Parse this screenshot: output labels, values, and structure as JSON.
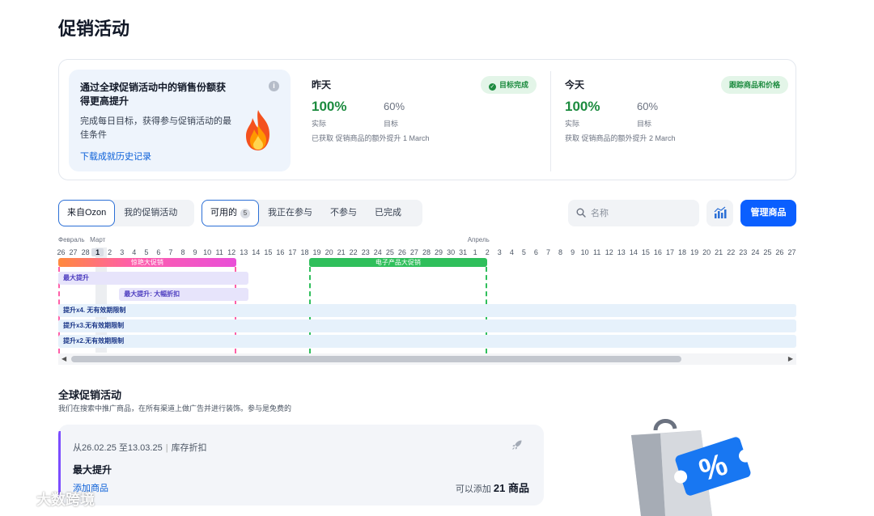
{
  "page": {
    "title": "促销活动"
  },
  "summary": {
    "promo": {
      "title": "通过全球促销活动中的销售份额获得更高提升",
      "description": "完成每日目标，获得参与促销活动的最佳条件",
      "link": "下载成就历史记录"
    },
    "yesterday": {
      "label": "昨天",
      "badge": "目标完成",
      "actual_value": "100%",
      "actual_label": "实际",
      "target_value": "60%",
      "target_label": "目标",
      "note": "已获取 促销商品的额外提升 1 March"
    },
    "today": {
      "label": "今天",
      "badge": "跟踪商品和价格",
      "actual_value": "100%",
      "actual_label": "实际",
      "target_value": "60%",
      "target_label": "目标",
      "note": "获取 促销商品的额外提升 2 March"
    }
  },
  "filters": {
    "source": [
      {
        "label": "来自Ozon",
        "active": true
      },
      {
        "label": "我的促销活动",
        "active": false
      }
    ],
    "status": [
      {
        "label": "可用的",
        "count": "5",
        "active": true
      },
      {
        "label": "我正在参与",
        "active": false
      },
      {
        "label": "不参与",
        "active": false
      },
      {
        "label": "已完成",
        "active": false
      }
    ],
    "search_placeholder": "名称",
    "manage_button": "管理商品"
  },
  "timeline": {
    "months": [
      "Февраль",
      "Март",
      "Апрель"
    ],
    "days": [
      "26",
      "27",
      "28",
      "1",
      "2",
      "3",
      "4",
      "5",
      "6",
      "7",
      "8",
      "9",
      "10",
      "11",
      "12",
      "13",
      "14",
      "15",
      "16",
      "17",
      "18",
      "19",
      "20",
      "21",
      "22",
      "23",
      "24",
      "25",
      "26",
      "27",
      "28",
      "29",
      "30",
      "31",
      "1",
      "2",
      "3",
      "4",
      "5",
      "6",
      "7",
      "8",
      "9",
      "10",
      "11",
      "12",
      "13",
      "14",
      "15",
      "16",
      "17",
      "18",
      "19",
      "20",
      "21",
      "22",
      "23",
      "24",
      "25",
      "26",
      "27"
    ],
    "today_index": 3,
    "campaigns": [
      {
        "label": "惊艳大促销",
        "start": 0,
        "end": 14.6,
        "color": "#ff5fa8"
      },
      {
        "label": "电子产品大促销",
        "start": 20.6,
        "end": 35.2,
        "color": "#2fbf5b"
      }
    ],
    "rows": [
      {
        "label": "最大提升",
        "start": 0,
        "end": 15.6,
        "color": "#e7e4fb",
        "text_color": "#4b3bbf"
      },
      {
        "label": "最大提升: 大幅折扣",
        "start": 5,
        "end": 15.6,
        "color": "#e7e4fb",
        "text_color": "#4b3bbf"
      },
      {
        "label": "提升x4. 无有效期限制",
        "start": 0,
        "end": 60.7,
        "color": "#e6f1fb",
        "text_color": "#1e3a8a"
      },
      {
        "label": "提升x3.无有效期限制",
        "start": 0,
        "end": 60.7,
        "color": "#e6f1fb",
        "text_color": "#1e3a8a"
      },
      {
        "label": "提升x2.无有效期限制",
        "start": 0,
        "end": 60.7,
        "color": "#e6f1fb",
        "text_color": "#1e3a8a"
      }
    ]
  },
  "global": {
    "title": "全球促销活动",
    "subtitle": "我们在搜索中推广商品，在所有渠道上做广告并进行装饰。参与是免费的",
    "card": {
      "dates": "从26.02.25 至13.03.25",
      "type": "库存折扣",
      "name": "最大提升",
      "add_link": "添加商品",
      "available_prefix": "可以添加",
      "available_count": "21 商品"
    }
  },
  "watermark": "大数跨境"
}
